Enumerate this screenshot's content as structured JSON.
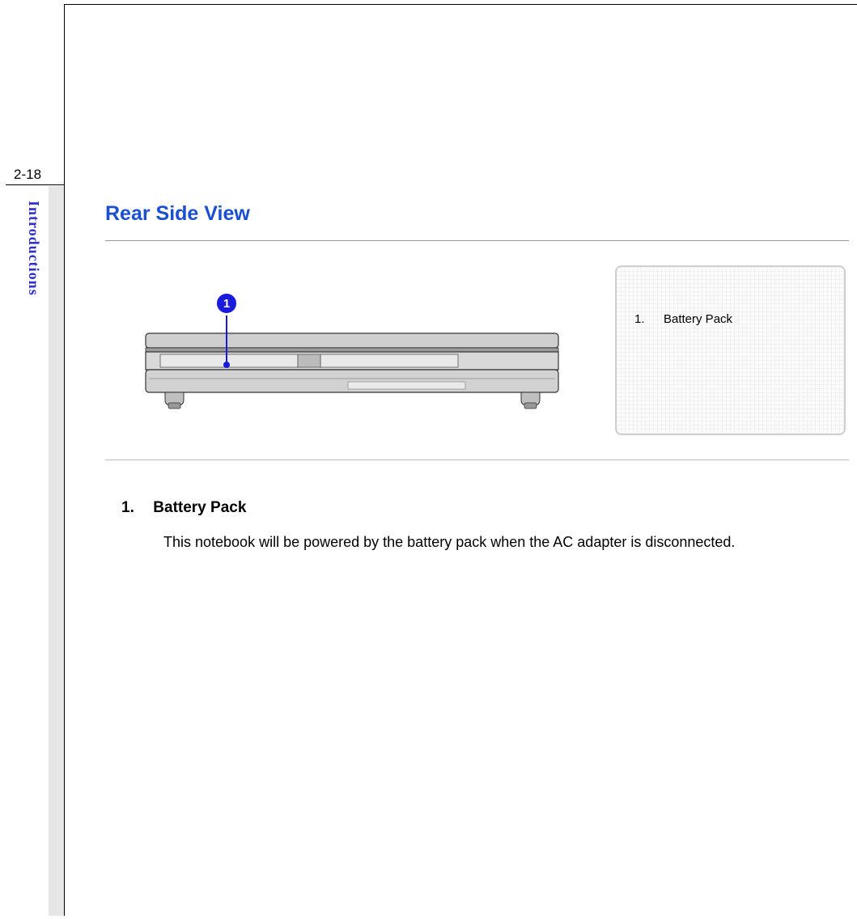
{
  "page_number": "2-18",
  "section_tab": "Introductions",
  "heading": "Rear Side View",
  "callout": {
    "number": "1"
  },
  "legend": {
    "items": [
      {
        "num": "1.",
        "label": "Battery Pack"
      }
    ]
  },
  "description": {
    "num": "1.",
    "title": "Battery Pack",
    "text": "This notebook will be powered by the battery pack when the AC adapter is disconnected."
  }
}
